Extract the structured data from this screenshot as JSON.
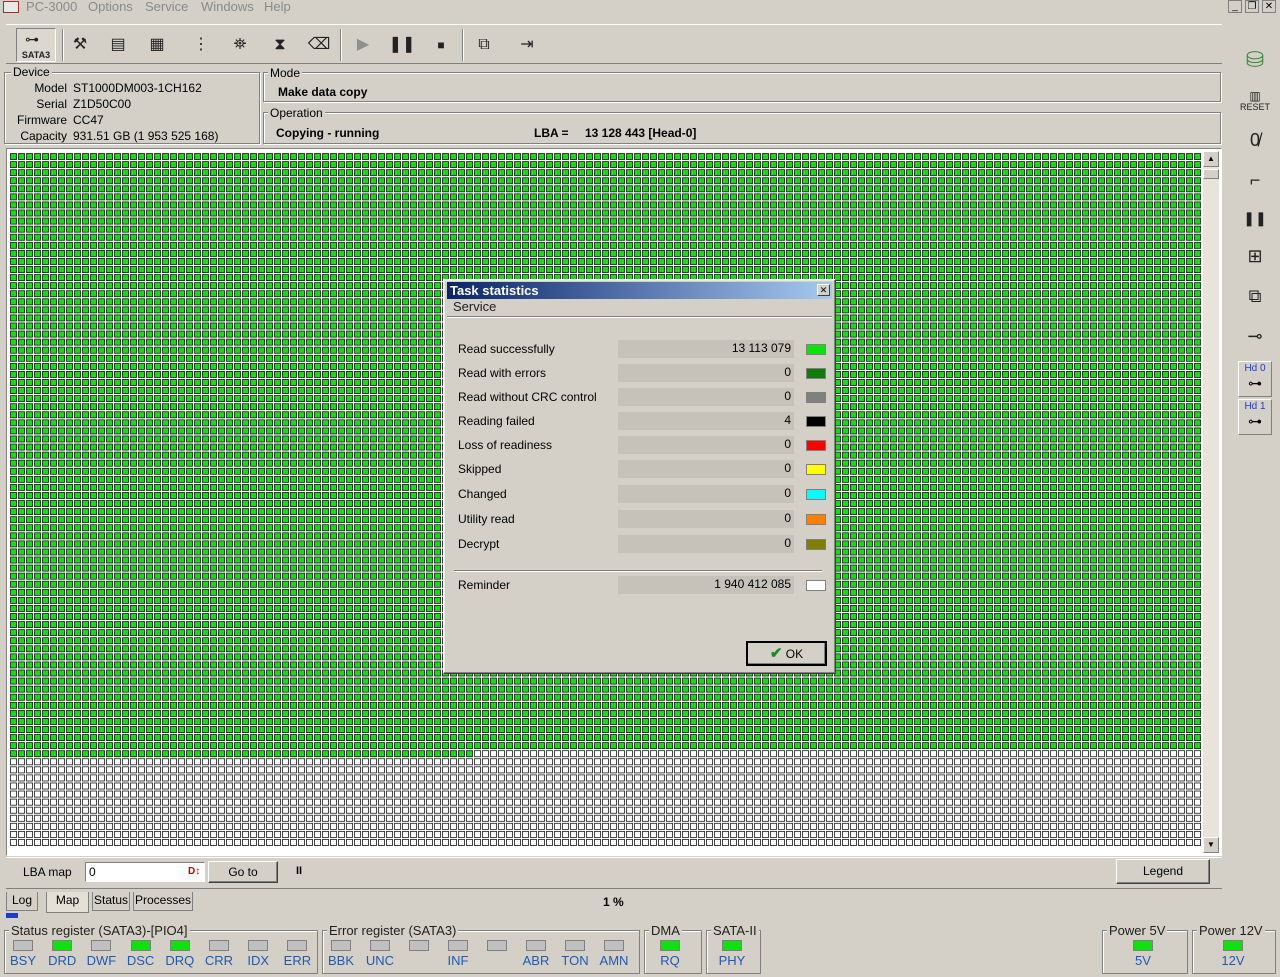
{
  "menubar": {
    "title": "PC-3000",
    "items": [
      "Options",
      "Service",
      "Windows",
      "Help"
    ]
  },
  "toolbar": {
    "interface_label": "SATA3"
  },
  "device": {
    "title": "Device",
    "model_key": "Model",
    "model": "ST1000DM003-1CH162",
    "serial_key": "Serial",
    "serial": "Z1D50C00",
    "firmware_key": "Firmware",
    "firmware": "CC47",
    "capacity_key": "Capacity",
    "capacity": "931.51 GB (1 953 525 168)"
  },
  "mode": {
    "title": "Mode",
    "value": "Make data copy"
  },
  "operation": {
    "title": "Operation",
    "status": "Copying - running",
    "lba_label": "LBA =",
    "lba_value": "13 128 443  [Head-0]"
  },
  "map": {
    "filled_fraction": 0.865,
    "colors": {
      "done": "#10e010",
      "pending": "#ffffff"
    }
  },
  "bottom": {
    "lba_map_label": "LBA map",
    "lba_input": "0",
    "goto_label": "Go to",
    "pause_symbol": "II",
    "legend_label": "Legend",
    "progress_text": "1 %",
    "tabs": [
      "Log",
      "Map",
      "Status",
      "Processes"
    ]
  },
  "registers": {
    "status": {
      "title": "Status register (SATA3)-[PIO4]",
      "leds": [
        {
          "label": "BSY",
          "on": false
        },
        {
          "label": "DRD",
          "on": true
        },
        {
          "label": "DWF",
          "on": false
        },
        {
          "label": "DSC",
          "on": true
        },
        {
          "label": "DRQ",
          "on": true
        },
        {
          "label": "CRR",
          "on": false
        },
        {
          "label": "IDX",
          "on": false
        },
        {
          "label": "ERR",
          "on": false
        }
      ]
    },
    "error": {
      "title": "Error register (SATA3)",
      "leds": [
        {
          "label": "BBK",
          "on": false
        },
        {
          "label": "UNC",
          "on": false
        },
        {
          "label": "",
          "on": false
        },
        {
          "label": "INF",
          "on": false
        },
        {
          "label": "",
          "on": false
        },
        {
          "label": "ABR",
          "on": false
        },
        {
          "label": "TON",
          "on": false
        },
        {
          "label": "AMN",
          "on": false
        }
      ]
    },
    "dma": {
      "title": "DMA",
      "leds": [
        {
          "label": "RQ",
          "on": true
        }
      ]
    },
    "sata": {
      "title": "SATA-II",
      "leds": [
        {
          "label": "PHY",
          "on": true
        }
      ]
    },
    "power5": {
      "title": "Power 5V",
      "leds": [
        {
          "label": "5V",
          "on": true
        }
      ]
    },
    "power12": {
      "title": "Power 12V",
      "leds": [
        {
          "label": "12V",
          "on": true
        }
      ]
    }
  },
  "right_panel": {
    "reset_label": "RESET",
    "hd0": "Hd 0",
    "hd1": "Hd 1"
  },
  "dialog": {
    "title": "Task statistics",
    "subtitle": "Service",
    "rows": [
      {
        "label": "Read successfully",
        "value": "13 113 079",
        "color": "#10e010"
      },
      {
        "label": "Read with errors",
        "value": "0",
        "color": "#107a10"
      },
      {
        "label": "Read without CRC control",
        "value": "0",
        "color": "#808080"
      },
      {
        "label": "Reading failed",
        "value": "4",
        "color": "#000000"
      },
      {
        "label": "Loss of readiness",
        "value": "0",
        "color": "#ff0000"
      },
      {
        "label": "Skipped",
        "value": "0",
        "color": "#ffff00"
      },
      {
        "label": "Changed",
        "value": "0",
        "color": "#00ffff"
      },
      {
        "label": "Utility read",
        "value": "0",
        "color": "#ff8000"
      },
      {
        "label": "Decrypt",
        "value": "0",
        "color": "#808000"
      }
    ],
    "reminder": {
      "label": "Reminder",
      "value": "1 940 412 085",
      "color": "#ffffff"
    },
    "ok_label": "OK"
  }
}
